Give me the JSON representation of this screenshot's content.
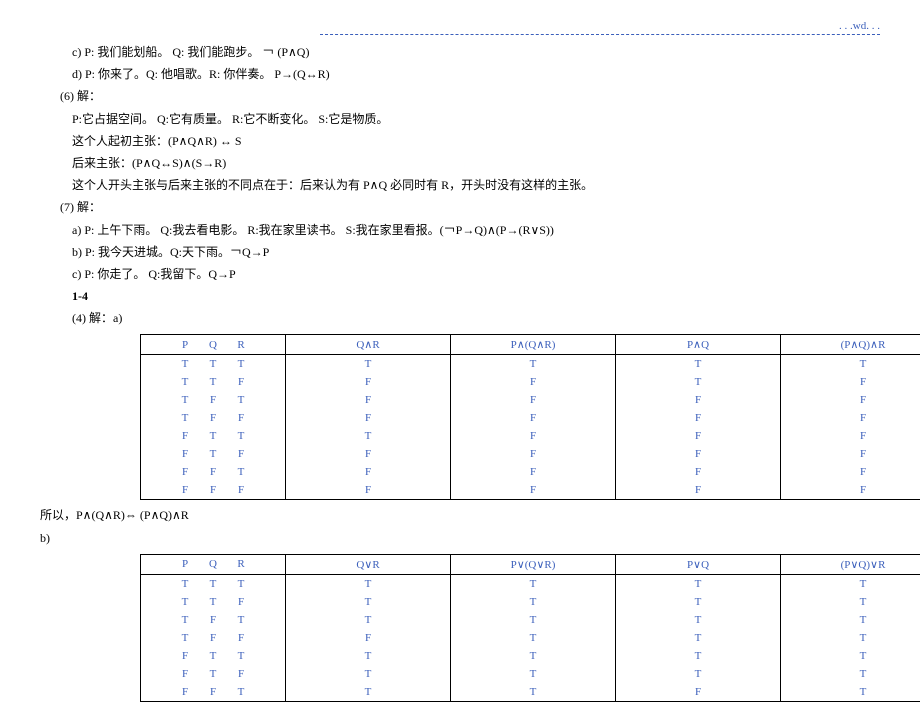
{
  "header": ". . .wd. . .",
  "lines": {
    "c": "c) P: 我们能划船。 Q: 我们能跑步。 ￢ (P∧Q)",
    "d": "d) P: 你来了。Q: 他唱歌。R: 你伴奏。 P→(Q↔R)",
    "p6": "(6) 解：",
    "p6a": "P:它占据空间。 Q:它有质量。 R:它不断变化。 S:它是物质。",
    "p6b": "这个人起初主张：(P∧Q∧R) ↔ S",
    "p6c": "后来主张：(P∧Q↔S)∧(S→R)",
    "p6d": "这个人开头主张与后来主张的不同点在于：后来认为有 P∧Q 必同时有 R，开头时没有这样的主张。",
    "p7": "(7) 解：",
    "p7a": "a) P: 上午下雨。 Q:我去看电影。 R:我在家里读书。 S:我在家里看报。(￢P→Q)∧(P→(R∨S))",
    "p7b": "b) P: 我今天进城。Q:天下雨。￢Q→P",
    "p7c": "c) P: 你走了。 Q:我留下。Q→P",
    "p14": "1-4",
    "p4sol": "(4) 解：a)",
    "conclusion_a": "所以，P∧(Q∧R)⇔ (P∧Q)∧R",
    "b_label": "b)"
  },
  "table_a": {
    "headers": {
      "pqr": "P    Q    R",
      "c1": "Q∧R",
      "c2": "P∧(Q∧R)",
      "c3": "P∧Q",
      "c4": "(P∧Q)∧R"
    },
    "rows": [
      {
        "p": "T",
        "q": "T",
        "r": "T",
        "c1": "T",
        "c2": "T",
        "c3": "T",
        "c4": "T"
      },
      {
        "p": "T",
        "q": "T",
        "r": "F",
        "c1": "F",
        "c2": "F",
        "c3": "T",
        "c4": "F"
      },
      {
        "p": "T",
        "q": "F",
        "r": "T",
        "c1": "F",
        "c2": "F",
        "c3": "F",
        "c4": "F"
      },
      {
        "p": "T",
        "q": "F",
        "r": "F",
        "c1": "F",
        "c2": "F",
        "c3": "F",
        "c4": "F"
      },
      {
        "p": "F",
        "q": "T",
        "r": "T",
        "c1": "T",
        "c2": "F",
        "c3": "F",
        "c4": "F"
      },
      {
        "p": "F",
        "q": "T",
        "r": "F",
        "c1": "F",
        "c2": "F",
        "c3": "F",
        "c4": "F"
      },
      {
        "p": "F",
        "q": "F",
        "r": "T",
        "c1": "F",
        "c2": "F",
        "c3": "F",
        "c4": "F"
      },
      {
        "p": "F",
        "q": "F",
        "r": "F",
        "c1": "F",
        "c2": "F",
        "c3": "F",
        "c4": "F"
      }
    ]
  },
  "table_b": {
    "headers": {
      "pqr": "P    Q    R",
      "c1": "Q∨R",
      "c2": "P∨(Q∨R)",
      "c3": "P∨Q",
      "c4": "(P∨Q)∨R"
    },
    "rows": [
      {
        "p": "T",
        "q": "T",
        "r": "T",
        "c1": "T",
        "c2": "T",
        "c3": "T",
        "c4": "T"
      },
      {
        "p": "T",
        "q": "T",
        "r": "F",
        "c1": "T",
        "c2": "T",
        "c3": "T",
        "c4": "T"
      },
      {
        "p": "T",
        "q": "F",
        "r": "T",
        "c1": "T",
        "c2": "T",
        "c3": "T",
        "c4": "T"
      },
      {
        "p": "T",
        "q": "F",
        "r": "F",
        "c1": "F",
        "c2": "T",
        "c3": "T",
        "c4": "T"
      },
      {
        "p": "F",
        "q": "T",
        "r": "T",
        "c1": "T",
        "c2": "T",
        "c3": "T",
        "c4": "T"
      },
      {
        "p": "F",
        "q": "T",
        "r": "F",
        "c1": "T",
        "c2": "T",
        "c3": "T",
        "c4": "T"
      },
      {
        "p": "F",
        "q": "F",
        "r": "T",
        "c1": "T",
        "c2": "T",
        "c3": "F",
        "c4": "T"
      }
    ]
  }
}
